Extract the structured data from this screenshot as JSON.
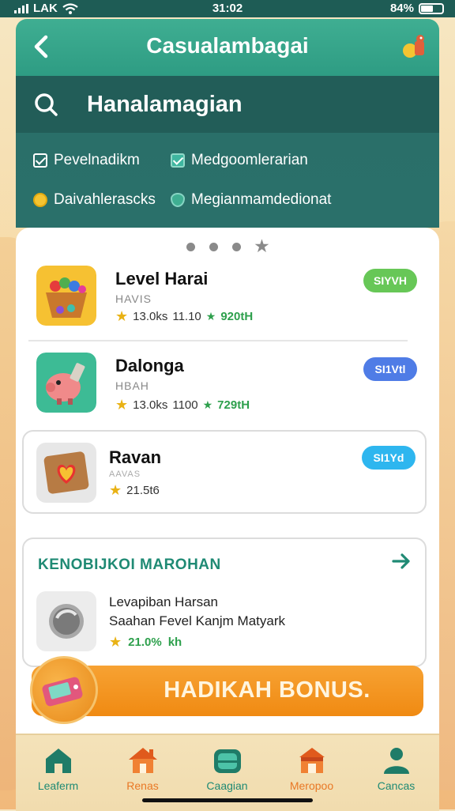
{
  "status_bar": {
    "carrier": "LAK",
    "time": "31:02",
    "battery": "84%"
  },
  "header": {
    "title": "Casualambagai",
    "back_icon": "chevron-left-icon",
    "mascot_icon": "mascot-icon"
  },
  "search": {
    "text": "Hanalamagian"
  },
  "filters": [
    {
      "label": "Pevelnadikm",
      "icon": "checkbox-icon",
      "checked": false
    },
    {
      "label": "Medgoomlerarian",
      "icon": "checkbox-icon",
      "checked": true
    },
    {
      "label": "Daivahlerascks",
      "icon": "coin-icon"
    },
    {
      "label": "Megianmamdedionat",
      "icon": "shield-icon"
    }
  ],
  "games": [
    {
      "name": "Level Harai",
      "sub": "HAVIS",
      "rating": "13.0ks",
      "count": "11.10",
      "green": "920tH",
      "badge": "SIYVH",
      "badge_color": "#67c757"
    },
    {
      "name": "Dalonga",
      "sub": "HBAH",
      "rating": "13.0ks",
      "count": "1100",
      "green": "729tH",
      "badge": "SI1Vtl",
      "badge_color": "#4f7ce6"
    },
    {
      "name": "Ravan",
      "sub": "AAVAS",
      "rating": "21.5t6",
      "badge": "SI1Yd",
      "badge_color": "#2eb6ef"
    }
  ],
  "section": {
    "title": "KENOBIJKOI MAROHAN",
    "item_title": "Levapiban Harsan",
    "item_desc": "Saahan Fevel Kanjm Matyark",
    "rating": "21.0%",
    "extra": "kh"
  },
  "bonus": {
    "label": "HADIKAH BONUS."
  },
  "tabs": [
    {
      "label": "Leaferm",
      "icon": "home-icon",
      "color": "#1f8a74"
    },
    {
      "label": "Renas",
      "icon": "house-icon",
      "color": "#e97825"
    },
    {
      "label": "Caagian",
      "icon": "chest-icon",
      "color": "#1f8a74"
    },
    {
      "label": "Meropoo",
      "icon": "shop-icon",
      "color": "#e97825"
    },
    {
      "label": "Cancas",
      "icon": "profile-icon",
      "color": "#1f8a74"
    }
  ]
}
